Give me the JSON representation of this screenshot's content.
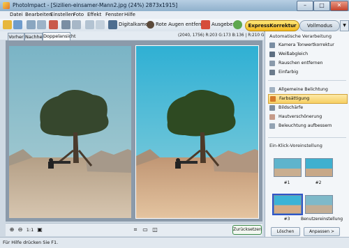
{
  "window": {
    "title": "PhotoImpact - [Sizilien-einsamer-Mann2.jpg (24%) 2873x1915]",
    "buttons": {
      "minimize": "–",
      "maximize": "□",
      "close": "✕"
    }
  },
  "menu": [
    "Datei",
    "Bearbeiten",
    "Einstellen",
    "Foto",
    "Effekt",
    "Fenster",
    "Hilfe"
  ],
  "toolbar": {
    "digitalkamera": "Digitalkamera",
    "rote_augen": "Rote Augen entfernen",
    "ausgeben": "Ausgeben",
    "express": "ExpressKorrektur",
    "vollmodus": "Vollmodus"
  },
  "tabs": [
    "Vorher",
    "Nachher",
    "Doppelansicht"
  ],
  "pixel_info": "(2040, 1756) R:203 G:173 B:136 | R:210 G:168 B:126",
  "bottom": {
    "reset": "Zurücksetzen",
    "zoom_level": "1:1"
  },
  "panel": {
    "section1": "Automatische Verarbeitung",
    "items1": [
      "Kamera Tonwertkorrektur",
      "Weißabgleich",
      "Rauschen entfernen",
      "Einfarbig"
    ],
    "items2": [
      "Allgemeine Belichtung",
      "Farbsättigung",
      "Bildschärfe",
      "Hautverschönerung",
      "Beleuchtung aufbessern"
    ],
    "selected_item": "Farbsättigung",
    "section2": "Ein-Klick-Voreinstellung",
    "presets": [
      "#1",
      "#2",
      "#3",
      "Benutzereinstellung"
    ],
    "buttons": {
      "delete": "Löschen",
      "adjust": "Anpassen >"
    }
  },
  "status": "Für Hilfe drücken Sie F1.",
  "colors": {
    "accent": "#f2b81e",
    "selection": "#f6cf62",
    "sky_before": "#7fb8c8",
    "sky_after": "#46b6d4"
  }
}
